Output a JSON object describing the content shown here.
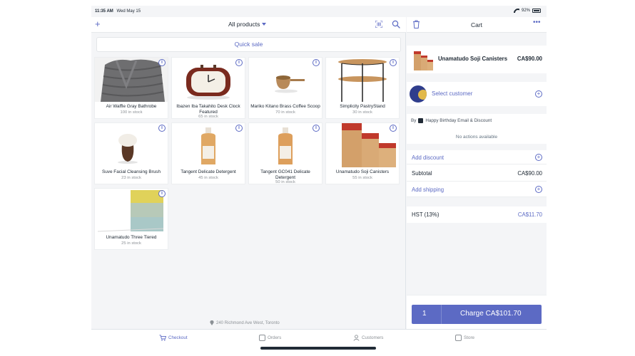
{
  "status_bar": {
    "time": "11:35 AM",
    "date": "Wed May 15",
    "battery": "92%"
  },
  "products_header": {
    "add_symbol": "+",
    "filter_label": "All products"
  },
  "quick_sale": {
    "label": "Quick sale"
  },
  "products": [
    {
      "name": "Air Waffle Gray Bathrobe",
      "stock": "100 in stock"
    },
    {
      "name": "Ibazen Iba Takahito Desk Clock Featured",
      "stock": "65 in stock"
    },
    {
      "name": "Mariko Kitano Brass Coffee Scoop",
      "stock": "70 in stock"
    },
    {
      "name": "Simplicity PastryStand",
      "stock": "30 in stock"
    },
    {
      "name": "Suve Facial Cleansing Brush",
      "stock": "23 in stock"
    },
    {
      "name": "Tangent Delicate Detergent",
      "stock": "45 in stock"
    },
    {
      "name": "Tangent GC041 Delicate Detergent",
      "stock": "50 in stock"
    },
    {
      "name": "Unamatudo Soji Canisters",
      "stock": "55 in stock"
    },
    {
      "name": "Unamatudo Three Tiered",
      "stock": "25 in stock"
    }
  ],
  "location": "240 Richmond Ave West, Toronto",
  "cart": {
    "title": "Cart",
    "more_symbol": "•••",
    "line_item": {
      "name": "Unamatudo Soji Canisters",
      "price": "CA$90.00"
    },
    "select_customer": "Select customer",
    "discount_by": "By",
    "discount_name": "Happy Birthday Email & Discount",
    "no_actions": "No actions available",
    "add_discount": "Add discount",
    "subtotal_label": "Subtotal",
    "subtotal_value": "CA$90.00",
    "add_shipping": "Add shipping",
    "tax_label": "HST (13%)",
    "tax_value": "CA$11.70",
    "charge_qty": "1",
    "charge_label": "Charge CA$101.70",
    "plus_symbol": "+"
  },
  "tabs": [
    {
      "label": "Checkout",
      "icon": "cart-icon",
      "active": true
    },
    {
      "label": "Orders",
      "icon": "orders-icon",
      "active": false
    },
    {
      "label": "Customers",
      "icon": "customers-icon",
      "active": false
    },
    {
      "label": "Store",
      "icon": "store-icon",
      "active": false
    }
  ],
  "colors": {
    "accent": "#5c6ac4",
    "text": "#212b36",
    "muted": "#8c9196",
    "background": "#f4f5f7"
  }
}
